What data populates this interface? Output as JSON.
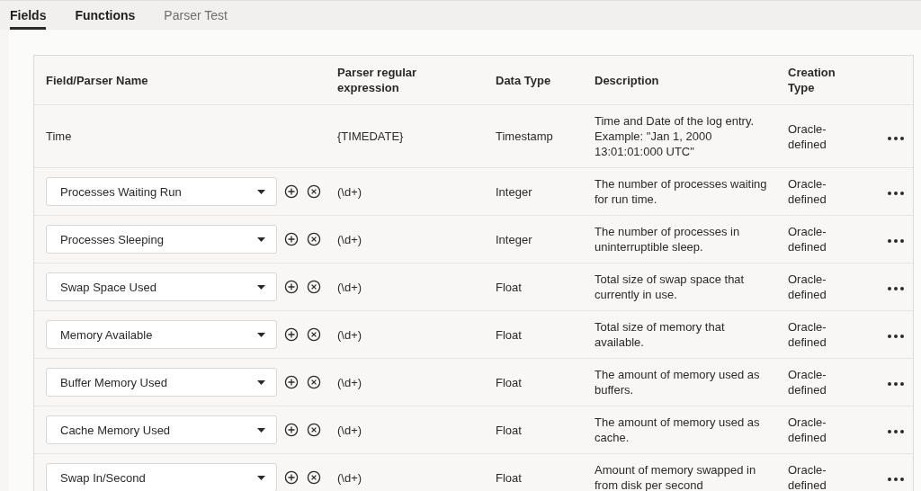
{
  "tabs": [
    {
      "label": "Fields",
      "selected": true,
      "disabled": false
    },
    {
      "label": "Functions",
      "selected": false,
      "disabled": false
    },
    {
      "label": "Parser Test",
      "selected": false,
      "disabled": true
    }
  ],
  "table": {
    "columns": [
      "Field/Parser Name",
      "Parser regular expression",
      "Data Type",
      "Description",
      "Creation Type"
    ],
    "rows": [
      {
        "kind": "text",
        "name": "Time",
        "regex": "{TIMEDATE}",
        "data_type": "Timestamp",
        "description": "Time and Date of the log entry. Example: \"Jan 1, 2000 13:01:01:000 UTC\"",
        "creation_type": "Oracle-defined"
      },
      {
        "kind": "select",
        "name": "Processes Waiting Run",
        "regex": "(\\d+)",
        "data_type": "Integer",
        "description": "The number of processes waiting for run time.",
        "creation_type": "Oracle-defined"
      },
      {
        "kind": "select",
        "name": "Processes Sleeping",
        "regex": "(\\d+)",
        "data_type": "Integer",
        "description": "The number of processes in uninterruptible sleep.",
        "creation_type": "Oracle-defined"
      },
      {
        "kind": "select",
        "name": "Swap Space Used",
        "regex": "(\\d+)",
        "data_type": "Float",
        "description": "Total size of swap space that currently in use.",
        "creation_type": "Oracle-defined"
      },
      {
        "kind": "select",
        "name": "Memory Available",
        "regex": "(\\d+)",
        "data_type": "Float",
        "description": "Total size of memory that available.",
        "creation_type": "Oracle-defined"
      },
      {
        "kind": "select",
        "name": "Buffer Memory Used",
        "regex": "(\\d+)",
        "data_type": "Float",
        "description": "The amount of memory used as buffers.",
        "creation_type": "Oracle-defined"
      },
      {
        "kind": "select",
        "name": "Cache Memory Used",
        "regex": "(\\d+)",
        "data_type": "Float",
        "description": "The amount of memory used as cache.",
        "creation_type": "Oracle-defined"
      },
      {
        "kind": "select",
        "name": "Swap In/Second",
        "regex": "(\\d+)",
        "data_type": "Float",
        "description": "Amount of memory swapped in from disk per second",
        "creation_type": "Oracle-defined"
      }
    ]
  }
}
